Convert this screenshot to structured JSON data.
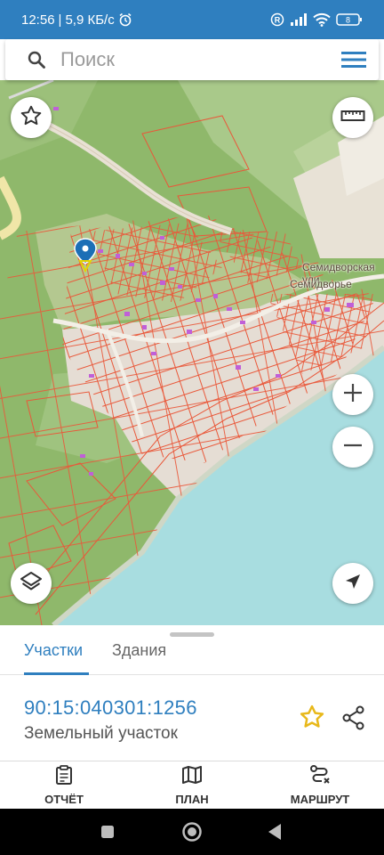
{
  "status_bar": {
    "time": "12:56",
    "speed": "5,9 КБ/с",
    "battery": "8",
    "icons": [
      "alarm-icon",
      "roaming-icon",
      "signal-icon",
      "wifi-icon",
      "battery-icon"
    ]
  },
  "search": {
    "placeholder": "Поиск",
    "icon": "search-icon",
    "menu_icon": "hamburger-menu-icon"
  },
  "map": {
    "labels": {
      "street": "Семидворская ули",
      "village": "Семидворье"
    },
    "controls": [
      "favorite-icon",
      "ruler-icon",
      "zoom-in-icon",
      "zoom-out-icon",
      "layers-icon",
      "navigate-icon"
    ],
    "colors": {
      "terrain": "#8fb86b",
      "hills": "#a9c98a",
      "town": "#e5ddd4",
      "sea": "#a8dde0",
      "parcel_lines": "#e9583a",
      "buildings": "#c05fd8",
      "marker": "#1c6fb6"
    }
  },
  "sheet": {
    "tabs": [
      "Участки",
      "Здания"
    ],
    "active_tab": "Участки",
    "parcel_id": "90:15:040301:1256",
    "parcel_type": "Земельный участок"
  },
  "bottom_nav": {
    "report": "ОТЧЁТ",
    "plan": "ПЛАН",
    "route": "МАРШРУТ"
  },
  "colors": {
    "accent": "#2f7fbf",
    "star": "#e8b81a"
  }
}
